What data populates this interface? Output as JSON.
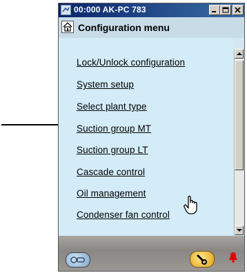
{
  "window": {
    "title": "00:000 AK-PC 783"
  },
  "header": {
    "title": "Configuration menu"
  },
  "menu": {
    "items": [
      {
        "label": "Lock/Unlock configuration"
      },
      {
        "label": "System setup"
      },
      {
        "label": "Select plant type"
      },
      {
        "label": "Suction group MT"
      },
      {
        "label": "Suction group LT"
      },
      {
        "label": "Cascade control"
      },
      {
        "label": "Oil management"
      },
      {
        "label": "Condenser fan control"
      }
    ]
  },
  "colors": {
    "content_bg": "#d4ecf8",
    "titlebar": "#0a246a",
    "bell": "#e00000",
    "tool_button": "#f5c02a"
  },
  "icons": [
    "app-icon",
    "home-icon",
    "minimize-icon",
    "maximize-icon",
    "close-icon",
    "scroll-up-icon",
    "scroll-down-icon",
    "connection-icon",
    "wrench-icon",
    "alarm-bell-icon",
    "pointer-arrow-icon",
    "hand-cursor-icon"
  ]
}
